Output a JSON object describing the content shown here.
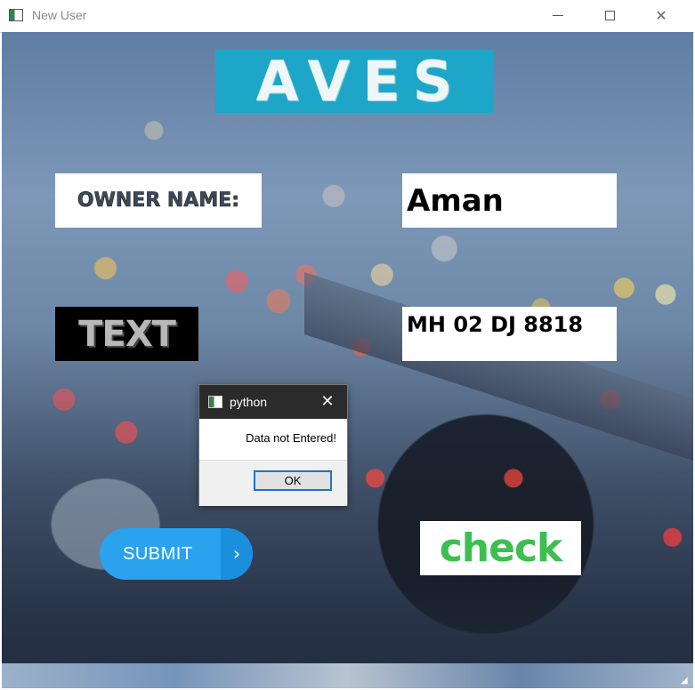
{
  "window": {
    "title": "New User",
    "controls": {
      "minimize_icon": "minimize-icon",
      "maximize_icon": "maximize-icon",
      "close_glyph": "✕"
    }
  },
  "form": {
    "logo_text": "AVES",
    "owner_label": "OWNER NAME:",
    "owner_value": "Aman",
    "text_label": "TEXT",
    "plate_value": "MH 02 DJ 8818",
    "submit_label": "SUBMIT",
    "submit_arrow": "›",
    "check_label": "check"
  },
  "dialog": {
    "title": "python",
    "close_glyph": "✕",
    "message": "Data not Entered!",
    "ok_label": "OK"
  },
  "colors": {
    "logo_bg": "#1ea6c8",
    "submit_bg": "#2aa2ee",
    "check_green": "#3cbf4f",
    "dialog_titlebar": "#2b2b2b",
    "ok_border": "#1a74c7"
  }
}
